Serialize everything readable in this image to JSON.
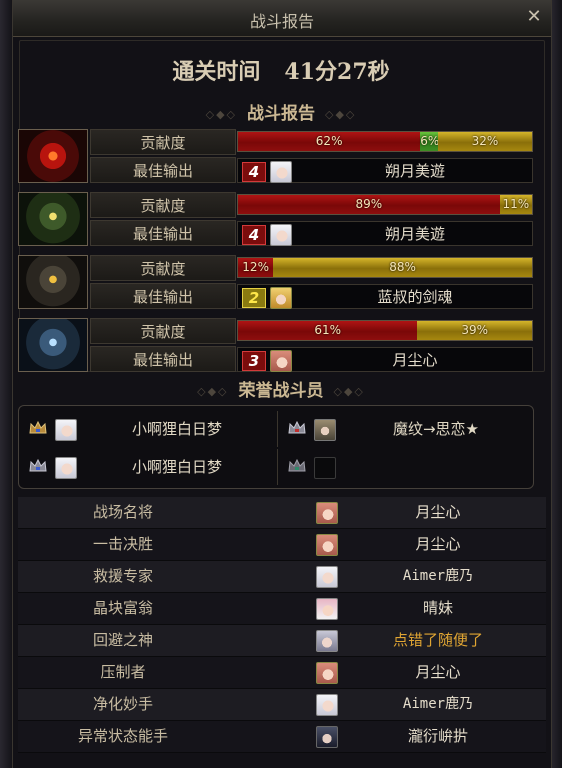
{
  "window": {
    "title": "战斗报告",
    "close_glyph": "✕"
  },
  "clear_time": {
    "label": "通关时间",
    "value": "41分27秒"
  },
  "report_title": "战斗报告",
  "labels": {
    "contribution": "贡献度",
    "best_output": "最佳输出"
  },
  "players": [
    {
      "portrait": "red-helmet-portrait",
      "contribution": [
        {
          "pct": 62,
          "text": "62%",
          "color": "red"
        },
        {
          "pct": 6,
          "text": "6%",
          "color": "green"
        },
        {
          "pct": 32,
          "text": "32%",
          "color": "gold"
        }
      ],
      "best": {
        "badge": "4",
        "badge_color": "red",
        "name": "朔月美遊",
        "face": "white-hair-face"
      }
    },
    {
      "portrait": "green-helmet-portrait",
      "contribution": [
        {
          "pct": 89,
          "text": "89%",
          "color": "red"
        },
        {
          "pct": 11,
          "text": "11%",
          "color": "gold"
        }
      ],
      "best": {
        "badge": "4",
        "badge_color": "red",
        "name": "朔月美遊",
        "face": "white-hair-face"
      }
    },
    {
      "portrait": "gold-helmet-portrait",
      "contribution": [
        {
          "pct": 12,
          "text": "12%",
          "color": "red"
        },
        {
          "pct": 88,
          "text": "88%",
          "color": "gold"
        }
      ],
      "best": {
        "badge": "2",
        "badge_color": "yellow",
        "name": "蓝叔的剑魂",
        "face": "blonde-face"
      }
    },
    {
      "portrait": "blue-helmet-portrait",
      "contribution": [
        {
          "pct": 61,
          "text": "61%",
          "color": "red"
        },
        {
          "pct": 39,
          "text": "39%",
          "color": "gold"
        }
      ],
      "best": {
        "badge": "3",
        "badge_color": "red",
        "name": "月尘心",
        "face": "pink-face"
      }
    }
  ],
  "honor_title": "荣誉战斗员",
  "honor": [
    {
      "name": "小啊狸白日梦",
      "face": "white-hair-face"
    },
    {
      "name": "魔纹→思恋★",
      "face": "armored-face"
    },
    {
      "name": "小啊狸白日梦",
      "face": "white-hair-face"
    },
    {
      "name": "",
      "face": "empty-slot"
    }
  ],
  "stats": [
    {
      "title": "战场名将",
      "name": "月尘心",
      "face": "pink-face",
      "style": ""
    },
    {
      "title": "一击决胜",
      "name": "月尘心",
      "face": "pink-face",
      "style": ""
    },
    {
      "title": "救援专家",
      "name": "Aimer鹿乃",
      "face": "white-hair-face",
      "style": "mono"
    },
    {
      "title": "晶块富翁",
      "name": "晴妹",
      "face": "pink-white-face",
      "style": ""
    },
    {
      "title": "回避之神",
      "name": "点错了随便了",
      "face": "silver-face",
      "style": "gold"
    },
    {
      "title": "压制者",
      "name": "月尘心",
      "face": "pink-face",
      "style": ""
    },
    {
      "title": "净化妙手",
      "name": "Aimer鹿乃",
      "face": "white-hair-face",
      "style": "mono"
    },
    {
      "title": "异常状态能手",
      "name": "瀧衍峅扸",
      "face": "dark-face",
      "style": ""
    }
  ],
  "colors": {
    "red": "#9a0f0f",
    "green": "#3f8f24",
    "gold": "#a7880f"
  }
}
